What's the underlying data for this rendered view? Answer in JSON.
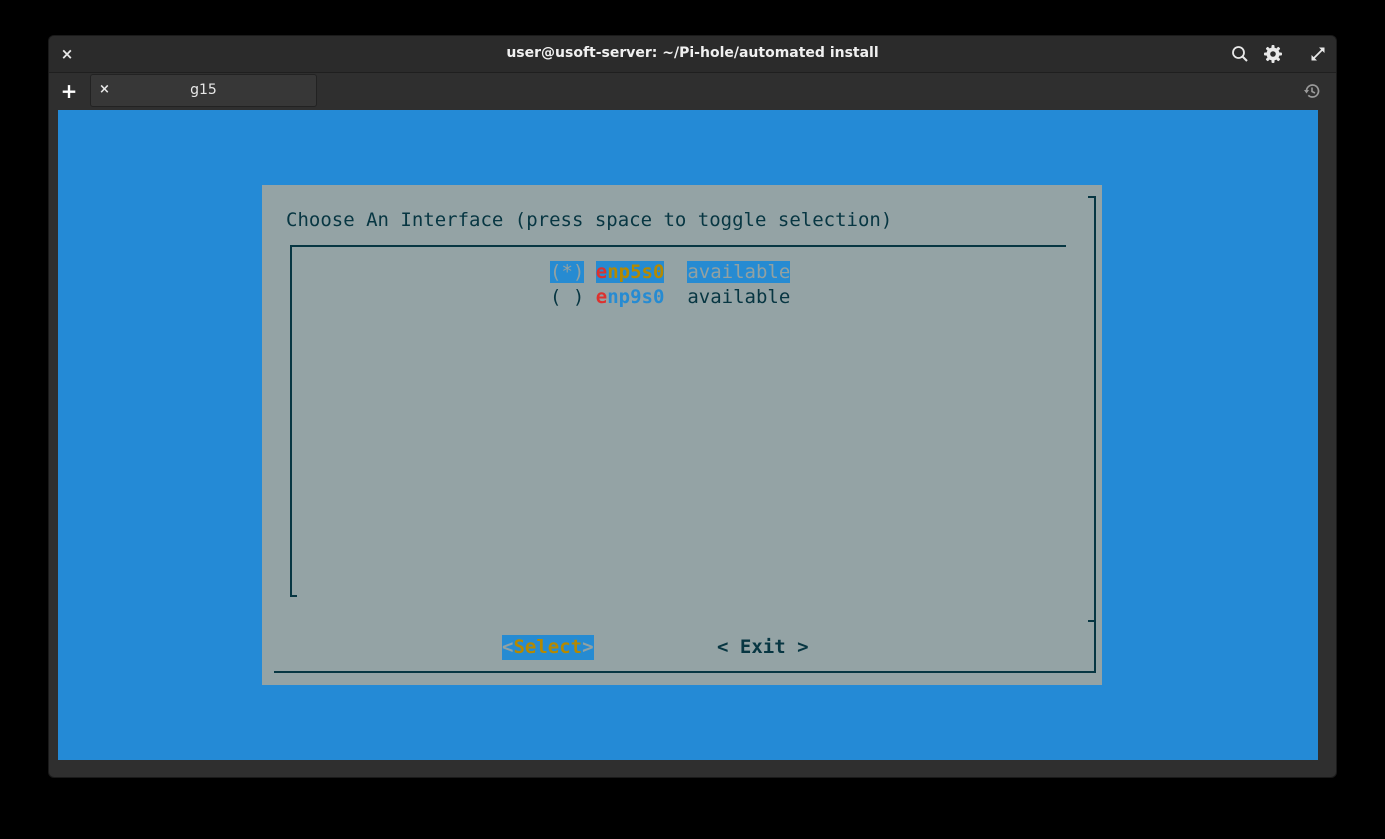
{
  "window": {
    "title": "user@usoft-server: ~/Pi-hole/automated install",
    "close_glyph": "×",
    "search_icon": "search-icon",
    "settings_icon": "gear-icon",
    "fullscreen_icon": "maximize-icon"
  },
  "tabs": {
    "new_tab_glyph": "+",
    "items": [
      {
        "label": "g15",
        "close_glyph": "×"
      }
    ],
    "history_icon": "history-icon"
  },
  "terminal": {
    "background": "#248ad6",
    "dialog": {
      "title": "Choose An Interface (press space to toggle selection)",
      "options": [
        {
          "marker": "(*)",
          "name_first": "e",
          "name_rest": "np5s0",
          "status": "available",
          "selected": true
        },
        {
          "marker": "( )",
          "name_first": "e",
          "name_rest": "np9s0",
          "status": "available",
          "selected": false
        }
      ],
      "buttons": {
        "select": {
          "left": "<",
          "first": "S",
          "rest": "elect",
          "right": ">"
        },
        "exit": "< Exit >"
      }
    }
  },
  "colors": {
    "dialog_bg": "#94a3a5",
    "text": "#073642",
    "highlight": "#268bd2",
    "hotkey_red": "#dc322f",
    "hotkey_yellow": "#b58900"
  }
}
